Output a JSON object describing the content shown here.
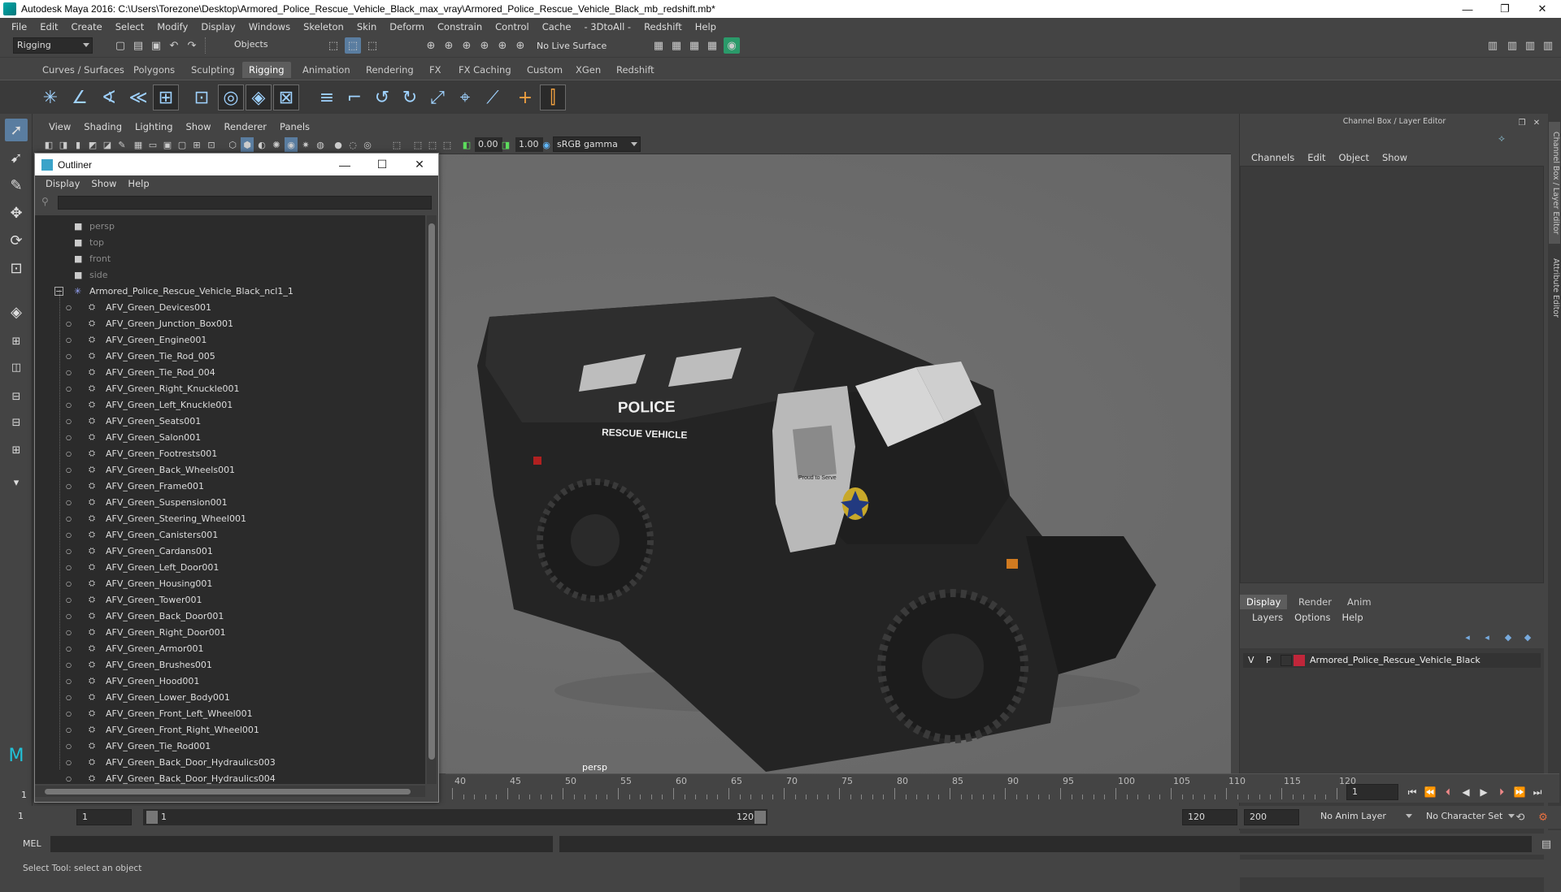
{
  "window": {
    "title": "Autodesk Maya 2016: C:\\Users\\Torezone\\Desktop\\Armored_Police_Rescue_Vehicle_Black_max_vray\\Armored_Police_Rescue_Vehicle_Black_mb_redshift.mb*"
  },
  "menubar": [
    "File",
    "Edit",
    "Create",
    "Select",
    "Modify",
    "Display",
    "Windows",
    "Skeleton",
    "Skin",
    "Deform",
    "Constrain",
    "Control",
    "Cache",
    "- 3DtoAll -",
    "Redshift",
    "Help"
  ],
  "statusline": {
    "menuset": "Rigging",
    "selection_mode": "Objects",
    "live_surface": "No Live Surface"
  },
  "shelf_tabs": [
    "Curves / Surfaces",
    "Polygons",
    "Sculpting",
    "Rigging",
    "Animation",
    "Rendering",
    "FX",
    "FX Caching",
    "Custom",
    "XGen",
    "Redshift"
  ],
  "shelf_active": "Rigging",
  "viewport": {
    "menu": [
      "View",
      "Shading",
      "Lighting",
      "Show",
      "Renderer",
      "Panels"
    ],
    "exposure": "0.00",
    "gamma": "1.00",
    "color_space": "sRGB gamma",
    "camera_label": "persp",
    "vehicle_text": {
      "line1": "POLICE",
      "line2": "RESCUE VEHICLE",
      "motto": "Proud to Serve"
    }
  },
  "outliner": {
    "title": "Outliner",
    "menu": [
      "Display",
      "Show",
      "Help"
    ],
    "cameras": [
      "persp",
      "top",
      "front",
      "side"
    ],
    "root": "Armored_Police_Rescue_Vehicle_Black_ncl1_1",
    "children": [
      "AFV_Green_Devices001",
      "AFV_Green_Junction_Box001",
      "AFV_Green_Engine001",
      "AFV_Green_Tie_Rod_005",
      "AFV_Green_Tie_Rod_004",
      "AFV_Green_Right_Knuckle001",
      "AFV_Green_Left_Knuckle001",
      "AFV_Green_Seats001",
      "AFV_Green_Salon001",
      "AFV_Green_Footrests001",
      "AFV_Green_Back_Wheels001",
      "AFV_Green_Frame001",
      "AFV_Green_Suspension001",
      "AFV_Green_Steering_Wheel001",
      "AFV_Green_Canisters001",
      "AFV_Green_Cardans001",
      "AFV_Green_Left_Door001",
      "AFV_Green_Housing001",
      "AFV_Green_Tower001",
      "AFV_Green_Back_Door001",
      "AFV_Green_Right_Door001",
      "AFV_Green_Armor001",
      "AFV_Green_Brushes001",
      "AFV_Green_Hood001",
      "AFV_Green_Lower_Body001",
      "AFV_Green_Front_Left_Wheel001",
      "AFV_Green_Front_Right_Wheel001",
      "AFV_Green_Tie_Rod001",
      "AFV_Green_Back_Door_Hydraulics003",
      "AFV_Green_Back_Door_Hydraulics004"
    ]
  },
  "channelbox": {
    "title": "Channel Box / Layer Editor",
    "menu": [
      "Channels",
      "Edit",
      "Object",
      "Show"
    ],
    "layer_tabs": [
      "Display",
      "Render",
      "Anim"
    ],
    "layer_menu": [
      "Layers",
      "Options",
      "Help"
    ],
    "layer": {
      "v": "V",
      "p": "P",
      "name": "Armored_Police_Rescue_Vehicle_Black",
      "color": "#c0263a"
    },
    "side_tabs": [
      "Channel Box / Layer Editor",
      "Attribute Editor"
    ]
  },
  "timeslider": {
    "ticks": [
      "40",
      "45",
      "50",
      "55",
      "60",
      "65",
      "70",
      "75",
      "80",
      "85",
      "90",
      "95",
      "100",
      "105",
      "110",
      "115",
      "120"
    ],
    "current_frame": "1"
  },
  "range": {
    "start": "1",
    "anim_start": "1",
    "slider_start": "1",
    "slider_end": "120",
    "end": "120",
    "anim_end": "200",
    "anim_layer": "No Anim Layer",
    "character_set": "No Character Set"
  },
  "cmdline": {
    "label": "MEL"
  },
  "helpline": {
    "text": "Select Tool: select an object"
  },
  "colors": {
    "accent": "#5a7da0",
    "ui_bg": "#444444",
    "viewport_bg": "#6e6e6e"
  }
}
